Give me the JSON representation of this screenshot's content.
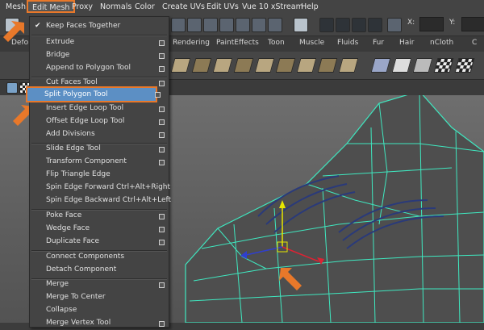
{
  "menubar": {
    "items": [
      "Mesh",
      "Edit Mesh",
      "Proxy",
      "Normals",
      "Color",
      "Create UVs",
      "Edit UVs",
      "Vue 10 xStream",
      "Help"
    ],
    "active": "Edit Mesh"
  },
  "toolbar": {
    "x_label": "X:",
    "y_label": "Y:"
  },
  "shelf": {
    "tabs": [
      "Defo",
      "Rendering",
      "PaintEffects",
      "Toon",
      "Muscle",
      "Fluids",
      "Fur",
      "Hair",
      "nCloth",
      "C"
    ]
  },
  "edit_mesh_menu": {
    "items": [
      {
        "label": "Keep Faces Together",
        "checked": true,
        "option": false
      },
      {
        "label": "Extrude",
        "option": true
      },
      {
        "label": "Bridge",
        "option": true
      },
      {
        "label": "Append to Polygon Tool",
        "option": true
      },
      {
        "label": "Cut Faces Tool",
        "option": true
      },
      {
        "label": "Split Polygon Tool",
        "option": true,
        "highlighted": true
      },
      {
        "label": "Insert Edge Loop Tool",
        "option": true
      },
      {
        "label": "Offset Edge Loop Tool",
        "option": true
      },
      {
        "label": "Add Divisions",
        "option": true
      },
      {
        "label": "Slide Edge Tool",
        "option": true
      },
      {
        "label": "Transform Component",
        "option": true
      },
      {
        "label": "Flip Triangle Edge",
        "option": false
      },
      {
        "label": "Spin Edge Forward  Ctrl+Alt+Right",
        "option": false
      },
      {
        "label": "Spin Edge Backward  Ctrl+Alt+Left",
        "option": false
      },
      {
        "label": "Poke Face",
        "option": true
      },
      {
        "label": "Wedge Face",
        "option": true
      },
      {
        "label": "Duplicate Face",
        "option": true
      },
      {
        "label": "Connect Components",
        "option": false
      },
      {
        "label": "Detach Component",
        "option": false
      },
      {
        "label": "Merge",
        "option": true
      },
      {
        "label": "Merge To Center",
        "option": false
      },
      {
        "label": "Collapse",
        "option": false
      },
      {
        "label": "Merge Vertex Tool",
        "option": true
      }
    ]
  },
  "colors": {
    "highlight_outline": "#e8782a",
    "highlight_fill": "#5c8fc4",
    "wireframe": "#3fe8c0",
    "mesh": "#4a4a4a"
  },
  "icons": [
    "check-icon",
    "option-box-icon",
    "pointer-arrow-icon",
    "manipulator-icon"
  ]
}
